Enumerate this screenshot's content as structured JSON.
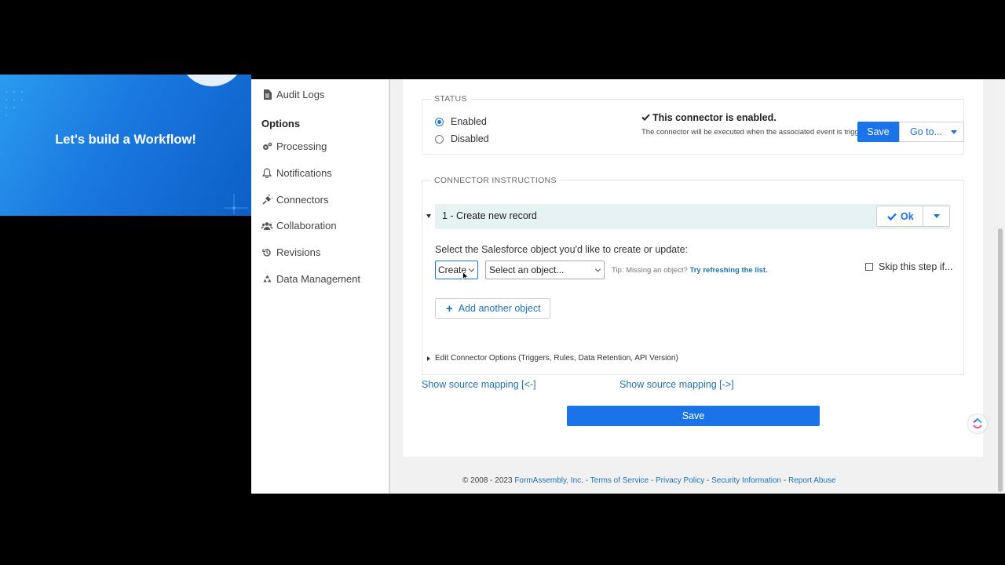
{
  "banner": {
    "title": "Let's build a Workflow!"
  },
  "sidebar": {
    "audit_logs": "Audit Logs",
    "options_heading": "Options",
    "items": [
      {
        "label": "Processing",
        "icon": "cogs-icon"
      },
      {
        "label": "Notifications",
        "icon": "bell-icon"
      },
      {
        "label": "Connectors",
        "icon": "plug-icon"
      },
      {
        "label": "Collaboration",
        "icon": "users-icon"
      },
      {
        "label": "Revisions",
        "icon": "history-icon"
      },
      {
        "label": "Data Management",
        "icon": "recycle-icon"
      }
    ]
  },
  "status": {
    "legend": "STATUS",
    "enabled_label": "Enabled",
    "disabled_label": "Disabled",
    "selected": "Enabled",
    "enabled_title": "This connector is enabled.",
    "enabled_desc": "The connector will be executed when the associated event is triggered.",
    "save_label": "Save",
    "goto_label": "Go to..."
  },
  "instructions": {
    "legend": "CONNECTOR INSTRUCTIONS",
    "step_title": "1 - Create new record",
    "ok_label": "Ok",
    "prompt": "Select the Salesforce object you'd like to create or update:",
    "action_value": "Create",
    "object_placeholder": "Select an object...",
    "tip_prefix": "Tip: Missing an object?",
    "tip_link": "Try refreshing the list.",
    "skip_label": "Skip this step if...",
    "add_label": "Add another object",
    "edit_options": "Edit Connector Options (Triggers, Rules, Data Retention, API Version)"
  },
  "mapping": {
    "left": "Show source mapping [<-]",
    "right": "Show source mapping [->]"
  },
  "save_label": "Save",
  "footer": {
    "copyright": "© 2008 - 2023",
    "links": [
      "FormAssembly, Inc.",
      "Terms of Service",
      "Privacy Policy",
      "Security Information",
      "Report Abuse"
    ],
    "separator": " - "
  },
  "colors": {
    "accent": "#1a73e8",
    "link": "#1f73b7",
    "step_bg": "#e7f3f3"
  }
}
